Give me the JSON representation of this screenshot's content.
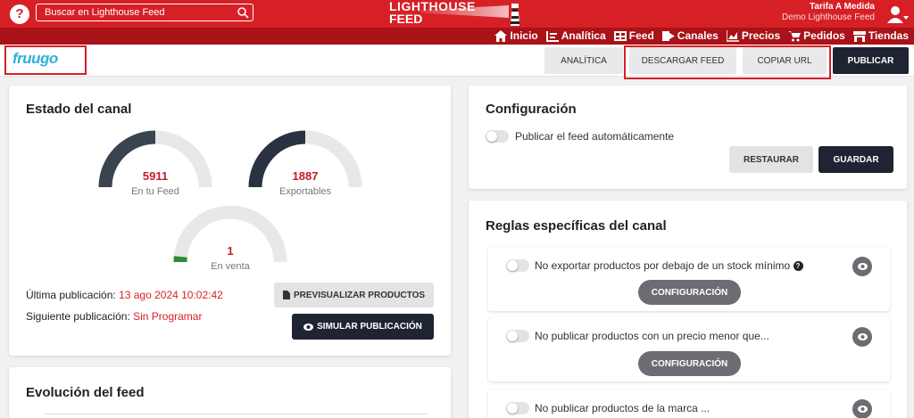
{
  "topbar": {
    "search_placeholder": "Buscar en Lighthouse Feed",
    "logo_line1": "LIGHTHOUSE",
    "logo_line2": "FEED",
    "user_name": "Tarifa A Medida",
    "user_sub": "Demo Lighthouse Feed"
  },
  "nav": [
    {
      "label": "Inicio",
      "icon": "home-icon"
    },
    {
      "label": "Analítica",
      "icon": "analytics-icon"
    },
    {
      "label": "Feed",
      "icon": "feed-icon"
    },
    {
      "label": "Canales",
      "icon": "channels-icon"
    },
    {
      "label": "Precios",
      "icon": "prices-icon"
    },
    {
      "label": "Pedidos",
      "icon": "cart-icon"
    },
    {
      "label": "Tiendas",
      "icon": "store-icon"
    }
  ],
  "header": {
    "channel_logo": "fruugo",
    "btn_analytics": "ANALÍTICA",
    "btn_download": "DESCARGAR FEED",
    "btn_copy": "COPIAR URL",
    "btn_publish": "PUBLICAR"
  },
  "status": {
    "title": "Estado del canal",
    "gauges": [
      {
        "value": "5911",
        "label": "En tu Feed",
        "fill": 0.5
      },
      {
        "value": "1887",
        "label": "Exportables",
        "fill": 0.5
      },
      {
        "value": "1",
        "label": "En venta",
        "fill": 0.01
      }
    ],
    "last_pub_label": "Última publicación:",
    "last_pub_value": "13 ago 2024 10:02:42",
    "next_pub_label": "Siguiente publicación:",
    "next_pub_value": "Sin Programar",
    "btn_preview": "PREVISUALIZAR PRODUCTOS",
    "btn_simulate": "SIMULAR PUBLICACIÓN"
  },
  "evolution": {
    "title": "Evolución del feed"
  },
  "config": {
    "title": "Configuración",
    "auto_publish": "Publicar el feed automáticamente",
    "btn_restore": "RESTAURAR",
    "btn_save": "GUARDAR"
  },
  "rules": {
    "title": "Reglas específicas del canal",
    "items": [
      {
        "text": "No exportar productos por debajo de un stock mínimo",
        "button": "CONFIGURACIÓN"
      },
      {
        "text": "No publicar productos con un precio menor que...",
        "button": "CONFIGURACIÓN"
      },
      {
        "text": "No publicar productos de la marca ..."
      }
    ]
  },
  "colors": {
    "primary_red": "#d71f26",
    "dark_red": "#a91218",
    "navy": "#1f2433",
    "gauge_dark": "#3a4350"
  }
}
